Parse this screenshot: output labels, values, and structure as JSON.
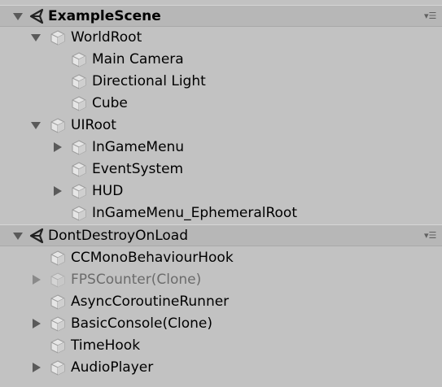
{
  "scenes": [
    {
      "name": "ExampleScene",
      "items": [
        {
          "label": "WorldRoot",
          "expanded": true
        },
        {
          "label": "Main Camera"
        },
        {
          "label": "Directional Light"
        },
        {
          "label": "Cube"
        },
        {
          "label": "UIRoot",
          "expanded": true
        },
        {
          "label": "InGameMenu",
          "expanded": false
        },
        {
          "label": "EventSystem"
        },
        {
          "label": "HUD",
          "expanded": false
        },
        {
          "label": "InGameMenu_EphemeralRoot"
        }
      ]
    },
    {
      "name": "DontDestroyOnLoad",
      "items": [
        {
          "label": "CCMonoBehaviourHook"
        },
        {
          "label": "FPSCounter(Clone)",
          "expanded": false,
          "inactive": true
        },
        {
          "label": "AsyncCoroutineRunner"
        },
        {
          "label": "BasicConsole(Clone)",
          "expanded": false
        },
        {
          "label": "TimeHook"
        },
        {
          "label": "AudioPlayer",
          "expanded": false
        }
      ]
    }
  ],
  "icons": {
    "scene": "unity-scene-icon",
    "gameobject": "cube-icon",
    "menu": "context-menu-icon"
  },
  "colors": {
    "background": "#c2c2c2",
    "scene_header": "#b7b7b7",
    "inactive_text": "#6b6b6b"
  }
}
